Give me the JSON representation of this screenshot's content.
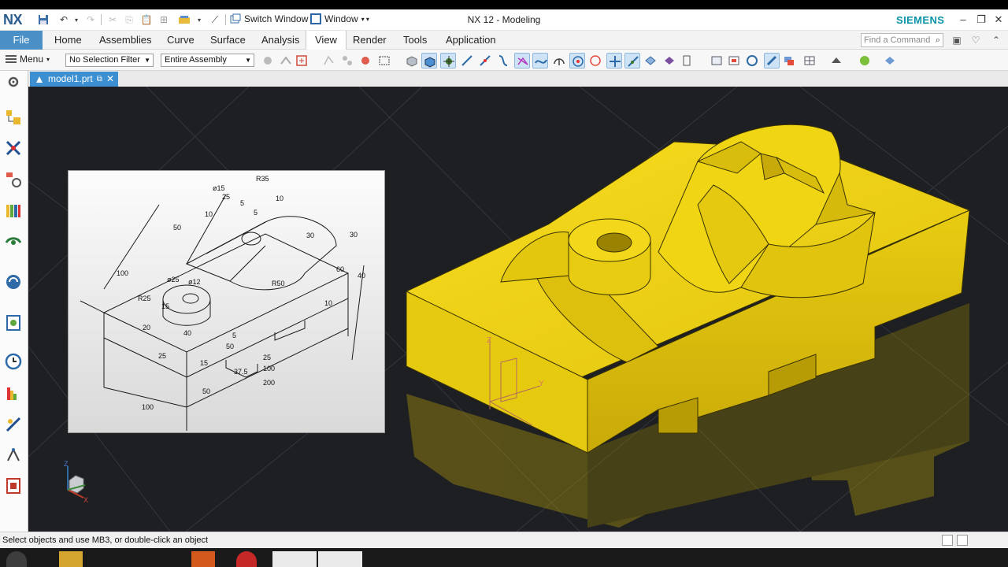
{
  "app": {
    "logo": "NX",
    "title": "NX 12 - Modeling",
    "brand": "SIEMENS",
    "switch_window": "Switch Window",
    "window_menu": "Window"
  },
  "ribbon": {
    "file": "File",
    "tabs": [
      "Home",
      "Assemblies",
      "Curve",
      "Surface",
      "Analysis",
      "View",
      "Render",
      "Tools",
      "Application"
    ],
    "active_tab": "View",
    "find_placeholder": "Find a Command"
  },
  "toolbar": {
    "menu": "Menu",
    "selection_filter": "No Selection Filter",
    "scope": "Entire Assembly"
  },
  "document": {
    "tab_name": "model1.prt"
  },
  "drawing": {
    "dims": [
      "R35",
      "ø15",
      "25",
      "5",
      "10",
      "10",
      "5",
      "50",
      "30",
      "30",
      "100",
      "ø25",
      "ø12",
      "R50",
      "60",
      "40",
      "R25",
      "15",
      "20",
      "40",
      "10",
      "5",
      "50",
      "25",
      "15",
      "25",
      "37.5",
      "100",
      "200",
      "50",
      "100"
    ]
  },
  "triad": {
    "x": "X",
    "y": "Y",
    "z": "Z"
  },
  "status": {
    "message": "Select objects and use MB3, or double-click an object"
  },
  "colors": {
    "accent": "#3c8fd1",
    "file_tab": "#4a8fc5",
    "viewport_bg": "#1d1f22",
    "model": "#e8cd12",
    "brand": "#0a93a6"
  }
}
